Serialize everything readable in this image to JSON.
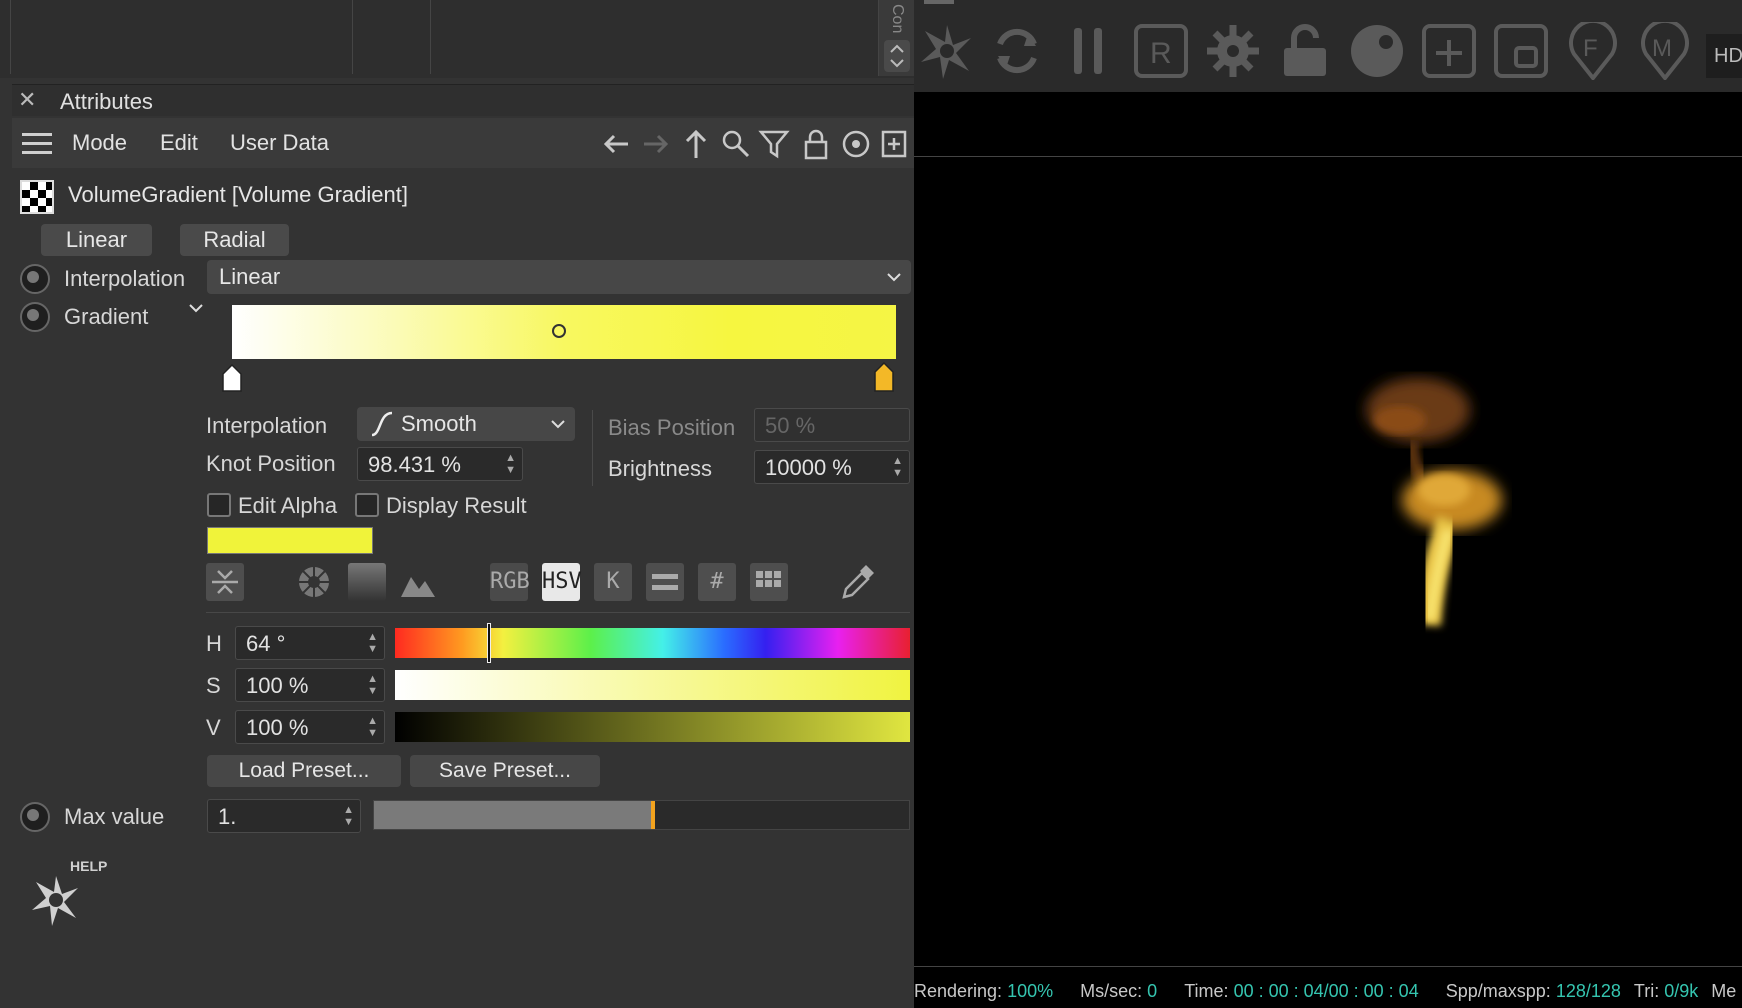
{
  "attributes_panel": {
    "title": "Attributes",
    "menu": [
      "Mode",
      "Edit",
      "User Data"
    ],
    "object_title": "VolumeGradient [Volume Gradient]",
    "tabs": [
      "Linear",
      "Radial"
    ],
    "interpolation": {
      "label": "Interpolation",
      "value": "Linear"
    },
    "gradient": {
      "label": "Gradient",
      "knot_interpolation": {
        "label": "Interpolation",
        "value": "Smooth"
      },
      "knot_position": {
        "label": "Knot Position",
        "value": "98.431 %"
      },
      "bias_position": {
        "label": "Bias Position",
        "value": "50 %"
      },
      "brightness": {
        "label": "Brightness",
        "value": "10000 %"
      },
      "edit_alpha": "Edit Alpha",
      "display_result": "Display Result",
      "swatch_color": "#f0f33a"
    },
    "color_modes": [
      "RGB",
      "HSV",
      "K",
      "#"
    ],
    "hsv": {
      "h": {
        "label": "H",
        "value": "64 °"
      },
      "s": {
        "label": "S",
        "value": "100 %"
      },
      "v": {
        "label": "V",
        "value": "100 %"
      }
    },
    "load_preset": "Load Preset...",
    "save_preset": "Save Preset...",
    "max_value": {
      "label": "Max value",
      "value": "1."
    },
    "help_label": "HELP",
    "side_tab": "Con"
  },
  "render_view": {
    "toolbar_right_label": "HD",
    "status": {
      "rendering_label": "Rendering:",
      "rendering_value": "100%",
      "ms_label": "Ms/sec:",
      "ms_value": "0",
      "time_label": "Time:",
      "time_value": "00 : 00 : 04/00 : 00 : 04",
      "spp_label": "Spp/maxspp:",
      "spp_value": "128/128",
      "tri_label": "Tri:",
      "tri_value": "0/9k",
      "me_label": "Me"
    }
  }
}
